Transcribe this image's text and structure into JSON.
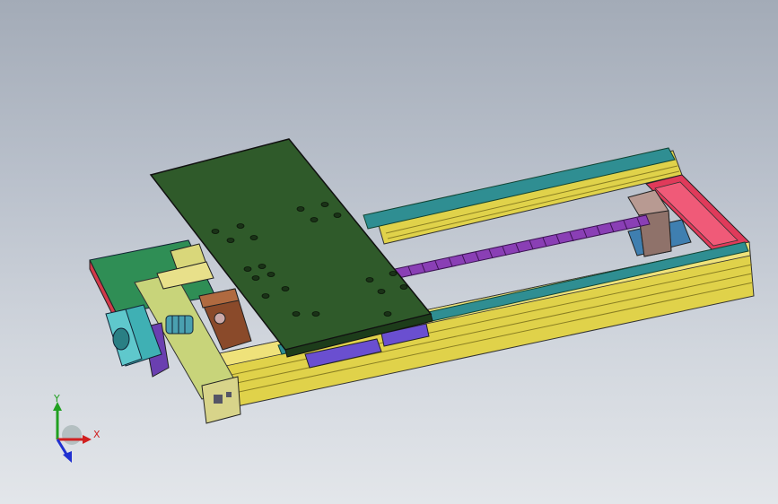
{
  "viewport": {
    "background_top": "#a3abb7",
    "background_bottom": "#e3e6ea"
  },
  "model": {
    "parts": [
      "aluminum-profile-frame",
      "linear-guide-rail",
      "carriage-plate",
      "ball-screw",
      "stepper-motor",
      "motor-mount",
      "coupling",
      "bearing-block",
      "end-plate"
    ],
    "colors": {
      "frame": "#e0d24a",
      "rail": "#2f8e92",
      "plate": "#2f5a2a",
      "screw": "#8a3fb5",
      "motor": "#3fb0b4",
      "bearing_block": "#b89a92",
      "end_plate": "#e03a5a",
      "base_plate": "#2f8e55",
      "mount": "#d9d77a"
    }
  },
  "triad": {
    "x_label": "X",
    "y_label": "Y",
    "x_color": "#d02020",
    "y_color": "#20a020",
    "z_color": "#2030d0"
  }
}
